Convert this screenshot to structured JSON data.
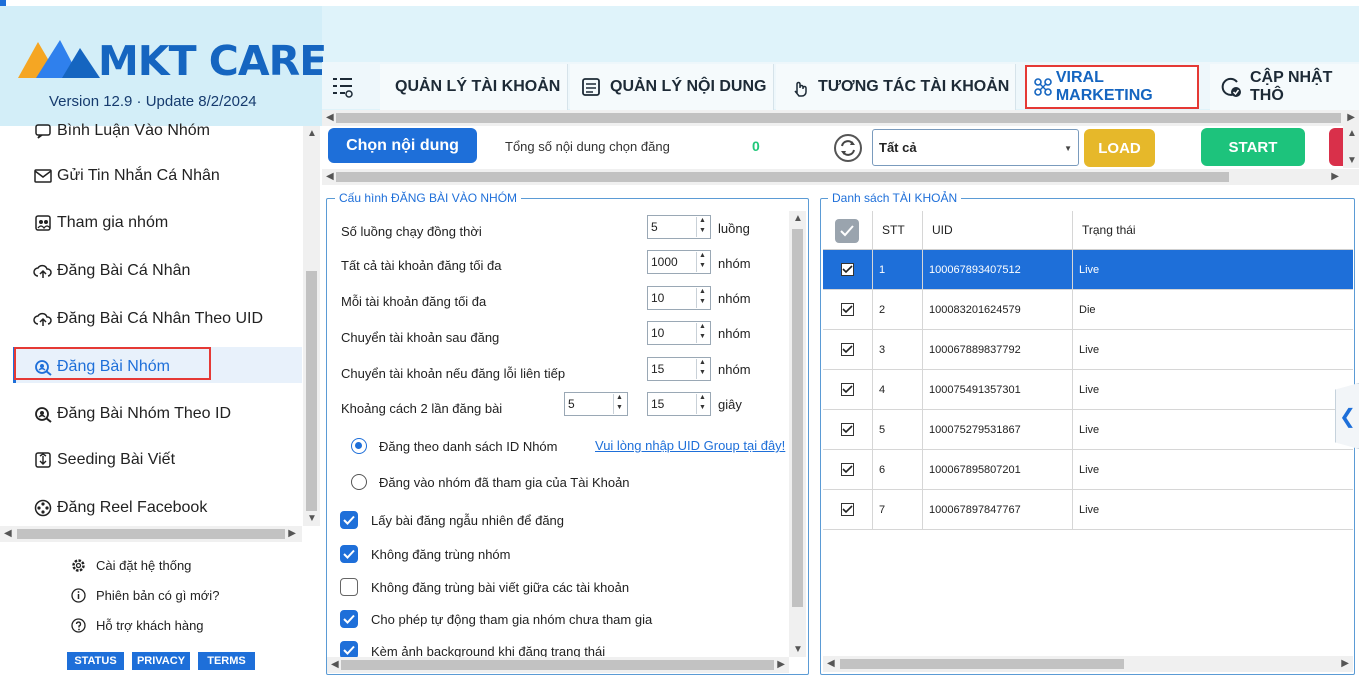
{
  "app": {
    "logo_text": "MKT CARE",
    "version_text": "Version  12.9 · Update  8/2/2024",
    "accent_color": "#1e6fd9",
    "highlight_color": "#e53935"
  },
  "tabs": [
    {
      "label": "QUẢN LÝ TÀI KHOẢN",
      "icon": "user-list-icon"
    },
    {
      "label": "QUẢN LÝ NỘI DUNG",
      "icon": "document-icon"
    },
    {
      "label": "TƯƠNG TÁC TÀI KHOẢN",
      "icon": "hand-pointer-icon"
    },
    {
      "label": "VIRAL MARKETING",
      "icon": "network-icon",
      "active": true
    },
    {
      "label": "CẬP NHẬT THÔ",
      "icon": "refresh-check-icon"
    }
  ],
  "sidebar": {
    "items": [
      {
        "label": "Bình Luận Vào Nhóm",
        "icon": "comment-group-icon"
      },
      {
        "label": "Gửi Tin Nhắn Cá Nhân",
        "icon": "mail-icon"
      },
      {
        "label": "Tham gia nhóm",
        "icon": "group-join-icon"
      },
      {
        "label": "Đăng Bài Cá Nhân",
        "icon": "cloud-upload-icon"
      },
      {
        "label": "Đăng Bài Cá Nhân Theo UID",
        "icon": "cloud-upload-icon"
      },
      {
        "label": "Đăng Bài Nhóm",
        "icon": "search-group-icon",
        "active": true
      },
      {
        "label": "Đăng Bài Nhóm Theo ID",
        "icon": "search-group-icon"
      },
      {
        "label": "Seeding Bài Viết",
        "icon": "seed-icon"
      },
      {
        "label": "Đăng Reel Facebook",
        "icon": "reel-icon"
      }
    ],
    "footer": [
      {
        "label": "Cài đặt hệ thống",
        "icon": "gear-icon"
      },
      {
        "label": "Phiên bản có gì mới?",
        "icon": "info-icon"
      },
      {
        "label": "Hỗ trợ khách hàng",
        "icon": "help-icon"
      }
    ],
    "footer_buttons": [
      "STATUS",
      "PRIVACY",
      "TERMS"
    ]
  },
  "toolbar": {
    "choose_content_label": "Chọn nội dung",
    "total_label": "Tổng số nội dung chọn đăng",
    "total_value": "0",
    "filter_value": "Tất cả",
    "load_label": "LOAD",
    "start_label": "START"
  },
  "config": {
    "legend": "Cấu hình ĐĂNG BÀI VÀO NHÓM",
    "rows": [
      {
        "label": "Số luồng chạy đồng thời",
        "value": "5",
        "unit": "luồng"
      },
      {
        "label": "Tất cả tài khoản đăng tối đa",
        "value": "1000",
        "unit": "nhóm"
      },
      {
        "label": "Mỗi tài khoản đăng tối đa",
        "value": "10",
        "unit": "nhóm"
      },
      {
        "label": "Chuyển tài khoản sau đăng",
        "value": "10",
        "unit": "nhóm"
      },
      {
        "label": "Chuyển tài khoản nếu đăng lỗi liên tiếp",
        "value": "15",
        "unit": "nhóm"
      }
    ],
    "interval": {
      "label": "Khoảng cách 2 lần đăng bài",
      "from": "5",
      "to": "15",
      "unit": "giây"
    },
    "radios": [
      {
        "label": "Đăng theo danh sách ID Nhóm",
        "selected": true
      },
      {
        "label": "Đăng vào nhóm đã tham gia của Tài Khoản",
        "selected": false
      }
    ],
    "link_label": "Vui lòng nhập UID Group tại đây!",
    "checkboxes": [
      {
        "label": "Lấy bài đăng ngẫu nhiên để đăng",
        "checked": true
      },
      {
        "label": "Không đăng trùng nhóm",
        "checked": true
      },
      {
        "label": "Không đăng trùng bài viết giữa các tài khoản",
        "checked": false
      },
      {
        "label": "Cho phép tự động tham gia nhóm chưa tham gia",
        "checked": true
      },
      {
        "label": "Kèm ảnh background khi đăng trạng thái",
        "checked": true
      }
    ]
  },
  "accounts": {
    "legend": "Danh sách TÀI KHOẢN",
    "columns": [
      "STT",
      "UID",
      "Trạng thái"
    ],
    "rows": [
      {
        "stt": "1",
        "uid": "100067893407512",
        "status": "Live",
        "selected": true
      },
      {
        "stt": "2",
        "uid": "100083201624579",
        "status": "Die"
      },
      {
        "stt": "3",
        "uid": "100067889837792",
        "status": "Live"
      },
      {
        "stt": "4",
        "uid": "100075491357301",
        "status": "Live"
      },
      {
        "stt": "5",
        "uid": "100075279531867",
        "status": "Live"
      },
      {
        "stt": "6",
        "uid": "100067895807201",
        "status": "Live"
      },
      {
        "stt": "7",
        "uid": "100067897847767",
        "status": "Live"
      }
    ]
  }
}
